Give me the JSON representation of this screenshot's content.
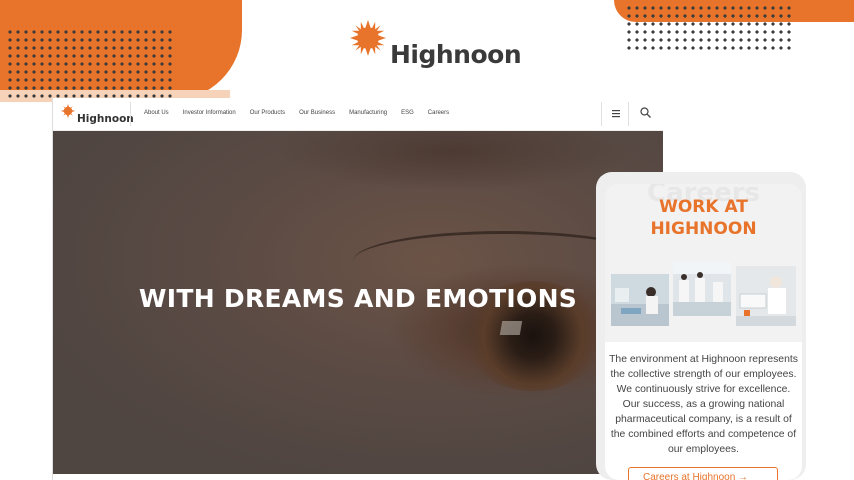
{
  "brand": {
    "name": "Highnoon",
    "accent_color": "#e8732a",
    "dark_text_color": "#3a3a3a"
  },
  "nav": {
    "logo_text": "Highnoon",
    "links": [
      "About Us",
      "Investor Information",
      "Our Products",
      "Our Business",
      "Manufacturing",
      "ESG",
      "Careers"
    ],
    "menu_icon": "hamburger-menu-icon",
    "search_icon": "search-icon"
  },
  "hero": {
    "headline": "WITH DREAMS AND EMOTIONS"
  },
  "careers_card": {
    "ghost_heading": "Careers",
    "title_line1": "WORK AT",
    "title_line2": "HIGHNOON",
    "body": "The environment at Highnoon represents the collective strength of our employees. We continuously strive for excellence. Our success, as a growing national pharmaceutical company, is a result of the combined efforts and competence of our employees.",
    "button_label": "Careers at Highnoon  →"
  }
}
